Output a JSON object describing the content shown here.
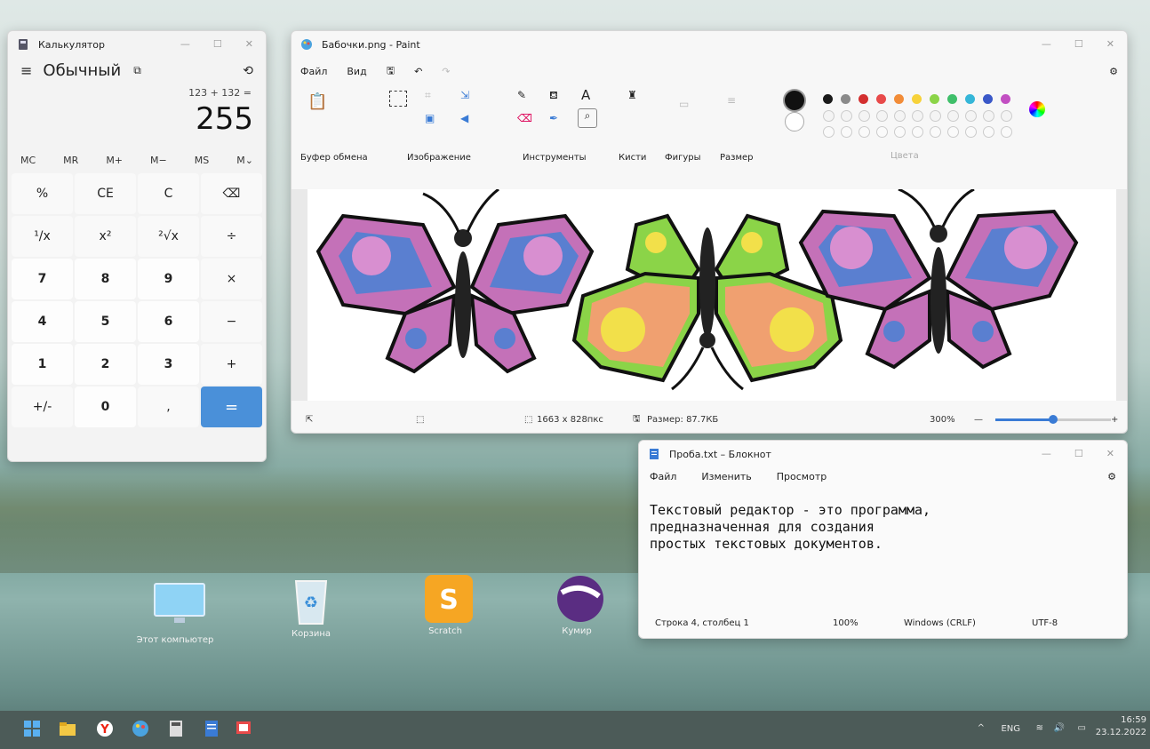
{
  "calculator": {
    "title": "Калькулятор",
    "mode": "Обычный",
    "expression": "123 + 132 =",
    "display": "255",
    "memory": [
      "MC",
      "MR",
      "M+",
      "M−",
      "MS",
      "M⌄"
    ],
    "keys": [
      "%",
      "CE",
      "C",
      "⌫",
      "¹/x",
      "x²",
      "²√x",
      "÷",
      "7",
      "8",
      "9",
      "×",
      "4",
      "5",
      "6",
      "−",
      "1",
      "2",
      "3",
      "+",
      "+/-",
      "0",
      ",",
      "="
    ]
  },
  "paint": {
    "title": "Бабочки.png - Paint",
    "menu": [
      "Файл",
      "Вид"
    ],
    "ribbon_labels": [
      "Буфер обмена",
      "Изображение",
      "Инструменты",
      "Кисти",
      "Фигуры",
      "Размер",
      "Цвета"
    ],
    "status": {
      "dimensions": "1663 x 828пкс",
      "size": "Размер: 87.7КБ",
      "zoom": "300%",
      "zoom_minus": "—",
      "zoom_plus": "+"
    },
    "palette": [
      "#1a1a1a",
      "#8a8a8a",
      "#d32f2f",
      "#e84a4a",
      "#f28c38",
      "#f7d23a",
      "#8bd448",
      "#3fbf6a",
      "#35b6d8",
      "#3a58c8",
      "#c24fc2"
    ]
  },
  "notepad": {
    "title": "Проба.txt – Блокнот",
    "menu": [
      "Файл",
      "Изменить",
      "Просмотр"
    ],
    "text": "Текстовый редактор - это программа,\nпредназначенная для создания\nпростых текстовых документов.",
    "status": {
      "position": "Строка 4, столбец 1",
      "zoom": "100%",
      "eol": "Windows (CRLF)",
      "encoding": "UTF-8"
    }
  },
  "desktop_icons": [
    "Этот компьютер",
    "Корзина",
    "Scratch",
    "Кумир"
  ],
  "taskbar": {
    "lang": "ENG",
    "time": "16:59",
    "date": "23.12.2022"
  }
}
